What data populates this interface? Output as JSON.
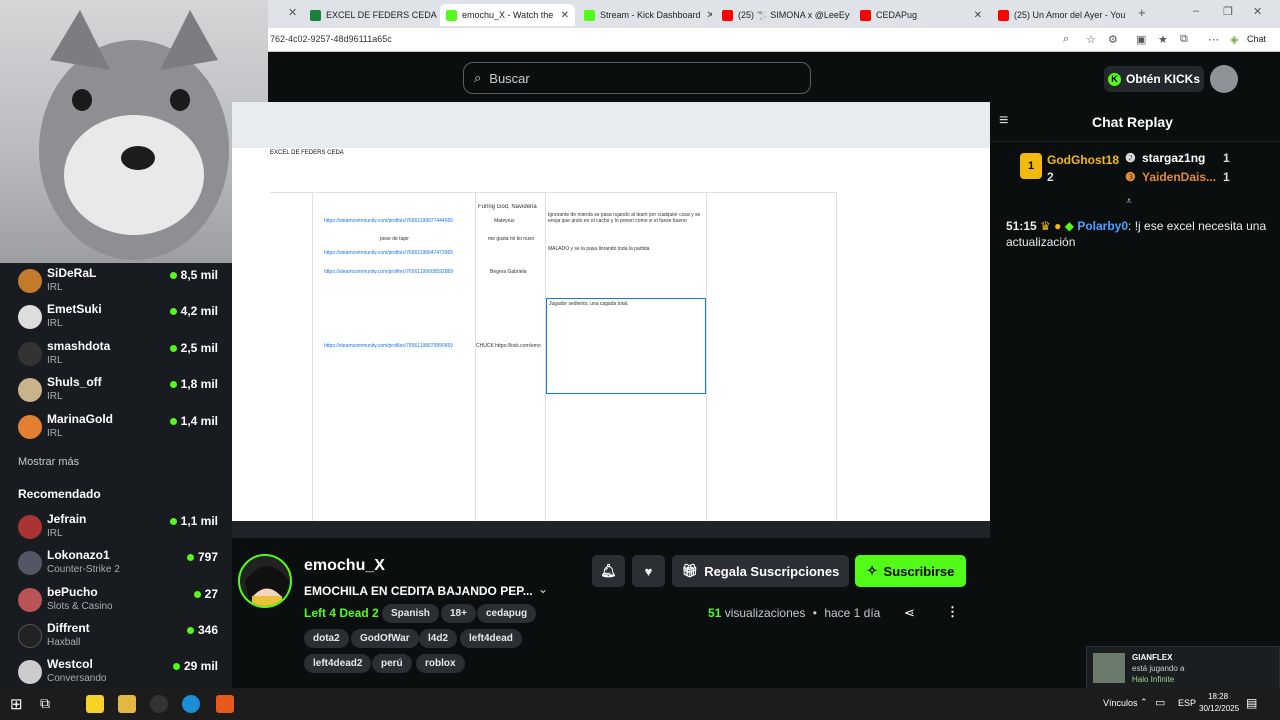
{
  "browser": {
    "tabs": [
      {
        "title": "EXCEL DE FEDERS CEDA - H",
        "color": "#188038"
      },
      {
        "title": "emochu_X - Watch the",
        "color": "#53fc18"
      },
      {
        "title": "Stream - Kick Dashboard",
        "color": "#53fc18"
      },
      {
        "title": "(25) 🐩 SIMONA x @LeeEye",
        "color": "#ff0000"
      },
      {
        "title": "CEDAPug",
        "color": "#ff0000"
      },
      {
        "title": "(25) Un Amor del Ayer - You",
        "color": "#ff0000"
      }
    ],
    "url": "762-4c02-9257-48d96111a65c",
    "chat_label": "Chat"
  },
  "kick_header": {
    "search_placeholder": "Buscar",
    "get_kicks": "Obtén KICKs"
  },
  "sidebar": {
    "channels": [
      {
        "name": "SiDeRaL",
        "sub": "IRL",
        "viewers": "8,5 mil",
        "color": "#c47a2c"
      },
      {
        "name": "EmetSuki",
        "sub": "IRL",
        "viewers": "4,2 mil",
        "color": "#ddd"
      },
      {
        "name": "smashdota",
        "sub": "IRL",
        "viewers": "2,5 mil",
        "color": "#333"
      },
      {
        "name": "Shuls_off",
        "sub": "IRL",
        "viewers": "1,8 mil",
        "color": "#c9b38a"
      },
      {
        "name": "MarinaGold",
        "sub": "IRL",
        "viewers": "1,4 mil",
        "color": "#e08030"
      }
    ],
    "show_more": "Mostrar más",
    "recommended_title": "Recomendado",
    "recommended": [
      {
        "name": "Jefrain",
        "sub": "IRL",
        "viewers": "1,1 mil",
        "color": "#a33"
      },
      {
        "name": "Lokonazo1",
        "sub": "Counter-Strike 2",
        "viewers": "797",
        "color": "#556"
      },
      {
        "name": "bePucho",
        "sub": "Slots & Casino",
        "viewers": "27",
        "color": "#b55"
      },
      {
        "name": "Diffrent",
        "sub": "Haxball",
        "viewers": "346",
        "color": "#222"
      },
      {
        "name": "Westcol",
        "sub": "Conversando",
        "viewers": "29 mil",
        "color": "#ccc"
      }
    ]
  },
  "video": {
    "sheet_title": "EXCEL DE FEDERS CEDA",
    "rows": [
      {
        "num": "",
        "link": "https://steamcommunity.com/profiles/76561199077444655",
        "name": "Mateyrus",
        "note": "Ignorante de mierda se pasa rujando al team por cualquier cosa y se enoja que ando en el cacho y lo ponen como si el fuese bueno"
      },
      {
        "num": "",
        "link": "",
        "name": "pese de tapir",
        "note": "me gusta mi tio nuvo"
      },
      {
        "num": "",
        "link": "https://steamcommunity.com/profiles/76561198047473965",
        "name": "",
        "note": ""
      },
      {
        "num": "",
        "link": "https://steamcommunity.com/profiles/76561199008592869",
        "name": "Begrea Gabriela",
        "note": "MALADO y se la pasa llorando toda la partida"
      },
      {
        "num": "",
        "link": "https://steamcommunity.com/profiles/76561198079990659",
        "name": "CHUCK https://kick.com/emo",
        "note": "Jugador sediento, una cagada total."
      }
    ],
    "header_cell": "Furing God, Navideña"
  },
  "stream": {
    "channel": "emochu_X",
    "title": "EMOCHILA EN CEDITA BAJANDO PEP...",
    "category": "Left 4 Dead 2",
    "tags_row1": [
      "Spanish",
      "18+",
      "cedapug"
    ],
    "tags_row2": [
      "dota2",
      "GodOfWar",
      "l4d2",
      "left4dead"
    ],
    "tags_row3": [
      "left4dead2",
      "perú",
      "roblox"
    ],
    "gift_label": "Regala Suscripciones",
    "subscribe_label": "Suscribirse",
    "views_count": "51",
    "views_label": "visualizaciones",
    "ago": "hace 1 día"
  },
  "chat": {
    "title": "Chat Replay",
    "gifters": [
      {
        "name": "GodGhost18",
        "count": "2"
      },
      {
        "name": "stargaz1ng",
        "count": "1"
      },
      {
        "name": "YaidenDais...",
        "count": "1"
      }
    ],
    "message": {
      "time": "51:15",
      "user": "Polarby0",
      "text": "!j ese excel necesita una actualización"
    }
  },
  "notification": {
    "name": "GIANFLEX",
    "line1": "está jugando a",
    "line2": "Halo Infinite"
  },
  "taskbar": {
    "links_label": "Vínculos",
    "lang": "ESP",
    "time": "18:28",
    "date": "30/12/2025"
  }
}
